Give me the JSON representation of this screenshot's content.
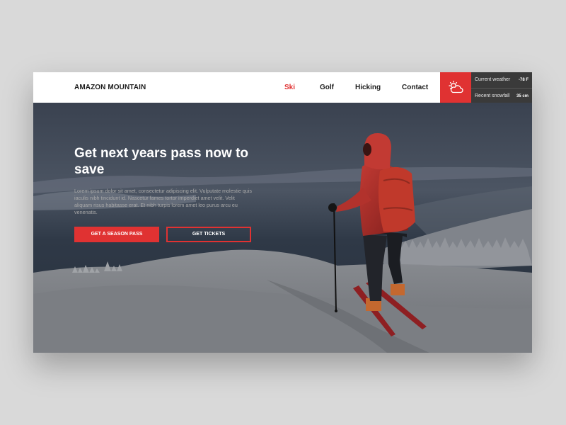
{
  "brand": {
    "name": "AMAZON MOUNTAIN"
  },
  "nav": {
    "items": [
      {
        "label": "Ski",
        "active": true
      },
      {
        "label": "Golf",
        "active": false
      },
      {
        "label": "Hicking",
        "active": false
      },
      {
        "label": "Contact",
        "active": false
      }
    ]
  },
  "weather": {
    "icon": "partly-cloudy-icon",
    "current_label": "Current weather",
    "current_value": "-78 F",
    "snow_label": "Recent snowfall",
    "snow_value": "35 cm"
  },
  "hero": {
    "headline": "Get next years pass now to save",
    "body": "Lorem ipsum dolor sit amet, consectetur adipiscing elit. Vulputate molestie quis iaculis nibh tincidunt id. Nascetur fames tortor imperdiet amet velit. Velit aliquam risus habitasse erat. Et nibh turpis lorem amet leo purus arcu eu venenatis.",
    "primary_button": "GET A SEASON PASS",
    "secondary_button": "GET TICKETS"
  },
  "colors": {
    "accent": "#e03232",
    "header_bg": "#ffffff",
    "weather_panel": "#3a3a3a"
  }
}
